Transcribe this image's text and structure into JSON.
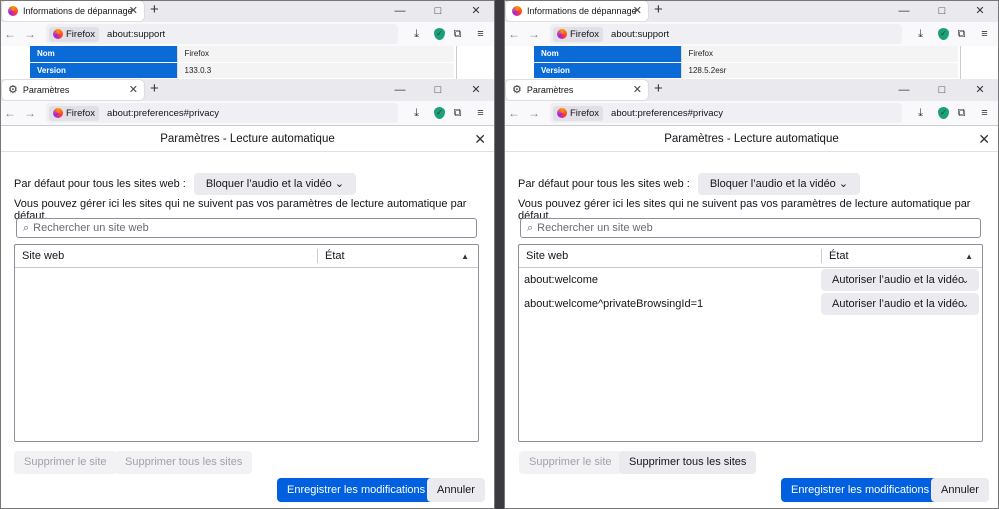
{
  "left": {
    "back_tab_title": "Informations de dépannage",
    "back_url": "about:support",
    "support_rows": [
      {
        "key": "Nom",
        "value": "Firefox"
      },
      {
        "key": "Version",
        "value": "133.0.3"
      }
    ],
    "front_tab_title": "Paramètres",
    "front_url": "about:preferences#privacy",
    "identity": "Firefox",
    "dialog_title": "Paramètres - Lecture automatique",
    "default_label": "Par défaut pour tous les sites web :",
    "default_value": "Bloquer l’audio et la vidéo",
    "description": "Vous pouvez gérer ici les sites qui ne suivent pas vos paramètres de lecture automatique par défaut.",
    "search_placeholder": "Rechercher un site web",
    "col_site": "Site web",
    "col_state": "État",
    "rows": [],
    "remove_site": "Supprimer le site",
    "remove_all": "Supprimer tous les sites",
    "save": "Enregistrer les modifications",
    "cancel": "Annuler"
  },
  "right": {
    "back_tab_title": "Informations de dépannage",
    "back_url": "about:support",
    "support_rows": [
      {
        "key": "Nom",
        "value": "Firefox"
      },
      {
        "key": "Version",
        "value": "128.5.2esr"
      }
    ],
    "front_tab_title": "Paramètres",
    "front_url": "about:preferences#privacy",
    "identity": "Firefox",
    "dialog_title": "Paramètres - Lecture automatique",
    "default_label": "Par défaut pour tous les sites web :",
    "default_value": "Bloquer l’audio et la vidéo",
    "description": "Vous pouvez gérer ici les sites qui ne suivent pas vos paramètres de lecture automatique par défaut.",
    "search_placeholder": "Rechercher un site web",
    "col_site": "Site web",
    "col_state": "État",
    "rows": [
      {
        "site": "about:welcome",
        "perm": "Autoriser l’audio et la vidéo"
      },
      {
        "site": "about:welcome^privateBrowsingId=1",
        "perm": "Autoriser l’audio et la vidéo"
      }
    ],
    "remove_site": "Supprimer le site",
    "remove_all": "Supprimer tous les sites",
    "save": "Enregistrer les modifications",
    "cancel": "Annuler"
  },
  "icons": {
    "back": "←",
    "forward": "→",
    "new_tab": "+",
    "close": "✕",
    "minimize": "—",
    "maximize": "□",
    "download": "⤓",
    "extensions": "⧉",
    "menu": "≡",
    "search": "⌕",
    "chevron": "⌄",
    "sort": "▲",
    "gear": "⚙"
  }
}
